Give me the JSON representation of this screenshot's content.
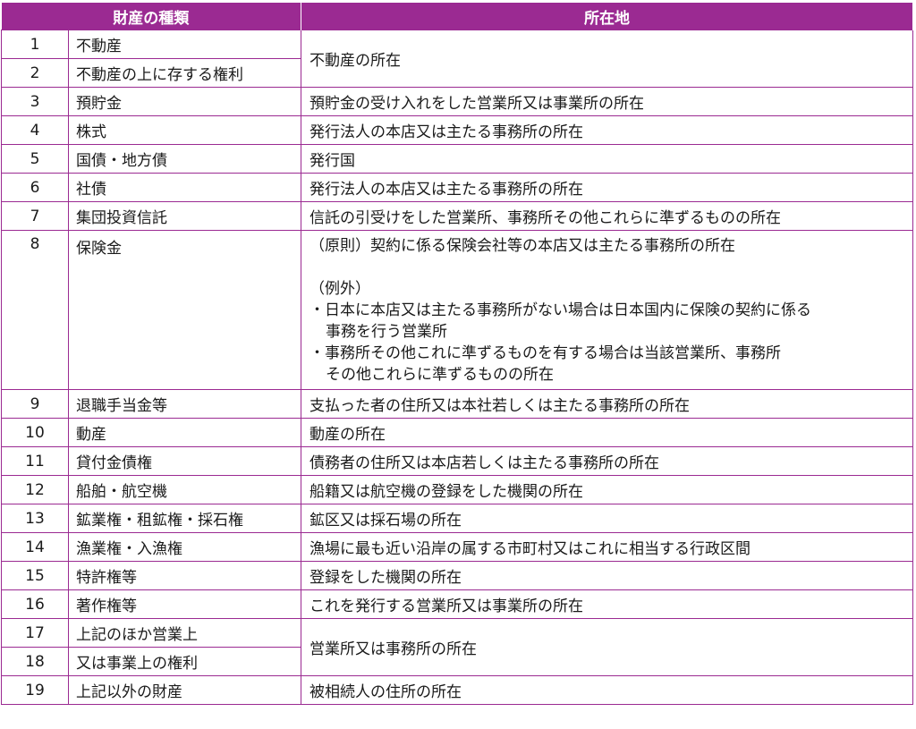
{
  "header": {
    "type_label": "財産の種類",
    "location_label": "所在地"
  },
  "rows": [
    {
      "no": "1",
      "type": "不動産",
      "location": "不動産の所在"
    },
    {
      "no": "2",
      "type": "不動産の上に存する権利"
    },
    {
      "no": "3",
      "type": "預貯金",
      "location": "預貯金の受け入れをした営業所又は事業所の所在"
    },
    {
      "no": "4",
      "type": "株式",
      "location": "発行法人の本店又は主たる事務所の所在"
    },
    {
      "no": "5",
      "type": "国債・地方債",
      "location": "発行国"
    },
    {
      "no": "6",
      "type": "社債",
      "location": "発行法人の本店又は主たる事務所の所在"
    },
    {
      "no": "7",
      "type": "集団投資信託",
      "location": "信託の引受けをした営業所、事務所その他これらに準ずるものの所在"
    },
    {
      "no": "8",
      "type": "保険金",
      "location_lines": [
        "（原則）契約に係る保険会社等の本店又は主たる事務所の所在",
        "（例外）",
        "・日本に本店又は主たる事務所がない場合は日本国内に保険の契約に係る",
        "事務を行う営業所",
        "・事務所その他これに準ずるものを有する場合は当該営業所、事務所",
        "その他これらに準ずるものの所在"
      ]
    },
    {
      "no": "9",
      "type": "退職手当金等",
      "location": "支払った者の住所又は本社若しくは主たる事務所の所在"
    },
    {
      "no": "10",
      "type": "動産",
      "location": "動産の所在"
    },
    {
      "no": "11",
      "type": "貸付金債権",
      "location": "債務者の住所又は本店若しくは主たる事務所の所在"
    },
    {
      "no": "12",
      "type": "船舶・航空機",
      "location": "船籍又は航空機の登録をした機関の所在"
    },
    {
      "no": "13",
      "type": "鉱業権・租鉱権・採石権",
      "location": "鉱区又は採石場の所在"
    },
    {
      "no": "14",
      "type": "漁業権・入漁権",
      "location": "漁場に最も近い沿岸の属する市町村又はこれに相当する行政区間"
    },
    {
      "no": "15",
      "type": "特許権等",
      "location": "登録をした機関の所在"
    },
    {
      "no": "16",
      "type": "著作権等",
      "location": "これを発行する営業所又は事業所の所在"
    },
    {
      "no": "17",
      "type": "上記のほか営業上",
      "location": "営業所又は事務所の所在"
    },
    {
      "no": "18",
      "type": "又は事業上の権利"
    },
    {
      "no": "19",
      "type": "上記以外の財産",
      "location": "被相続人の住所の所在"
    }
  ],
  "colors": {
    "header_bg": "#9b2a92",
    "border": "#9b2a92"
  }
}
